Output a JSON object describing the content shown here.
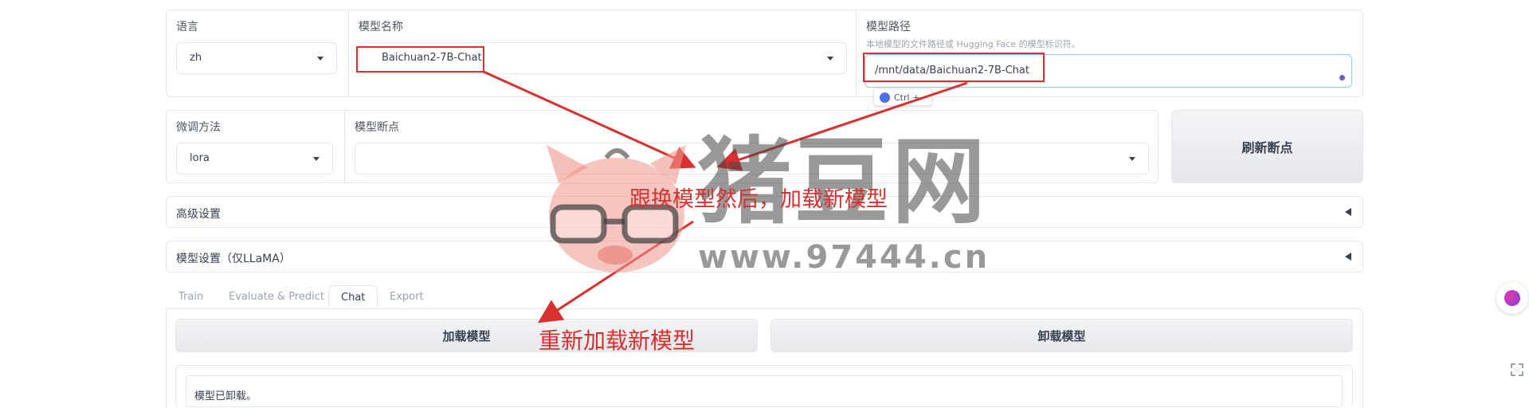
{
  "top_row": {
    "language": {
      "label": "语言",
      "value": "zh"
    },
    "model_name": {
      "label": "模型名称",
      "value": "Baichuan2-7B-Chat"
    },
    "model_path": {
      "label": "模型路径",
      "hint": "本地模型的文件路径或 Hugging Face 的模型标识符。",
      "value": "/mnt/data/Baichuan2-7B-Chat"
    },
    "shortcut_chip": "Ctrl +"
  },
  "second_row": {
    "finetune": {
      "label": "微调方法",
      "value": "lora"
    },
    "checkpoint": {
      "label": "模型断点",
      "value": ""
    },
    "refresh_button": "刷新断点"
  },
  "accordions": {
    "advanced": "高级设置",
    "model_settings": "模型设置（仅LLaMA）"
  },
  "tabs": [
    {
      "label": "Train",
      "active": false
    },
    {
      "label": "Evaluate & Predict",
      "active": false
    },
    {
      "label": "Chat",
      "active": true
    },
    {
      "label": "Export",
      "active": false
    }
  ],
  "chat": {
    "load_button": "加载模型",
    "unload_button": "卸载模型",
    "status": "模型已卸载。"
  },
  "annotations": {
    "switch_then_load": "跟换模型然后，加载新模型",
    "reload_new_model": "重新加载新模型"
  },
  "watermark": {
    "brand": "猪豆网",
    "url": "www.97444.cn"
  },
  "colors": {
    "annotation_red": "#d93030",
    "focus_blue": "#93c5fd",
    "border": "#e5e7eb"
  }
}
